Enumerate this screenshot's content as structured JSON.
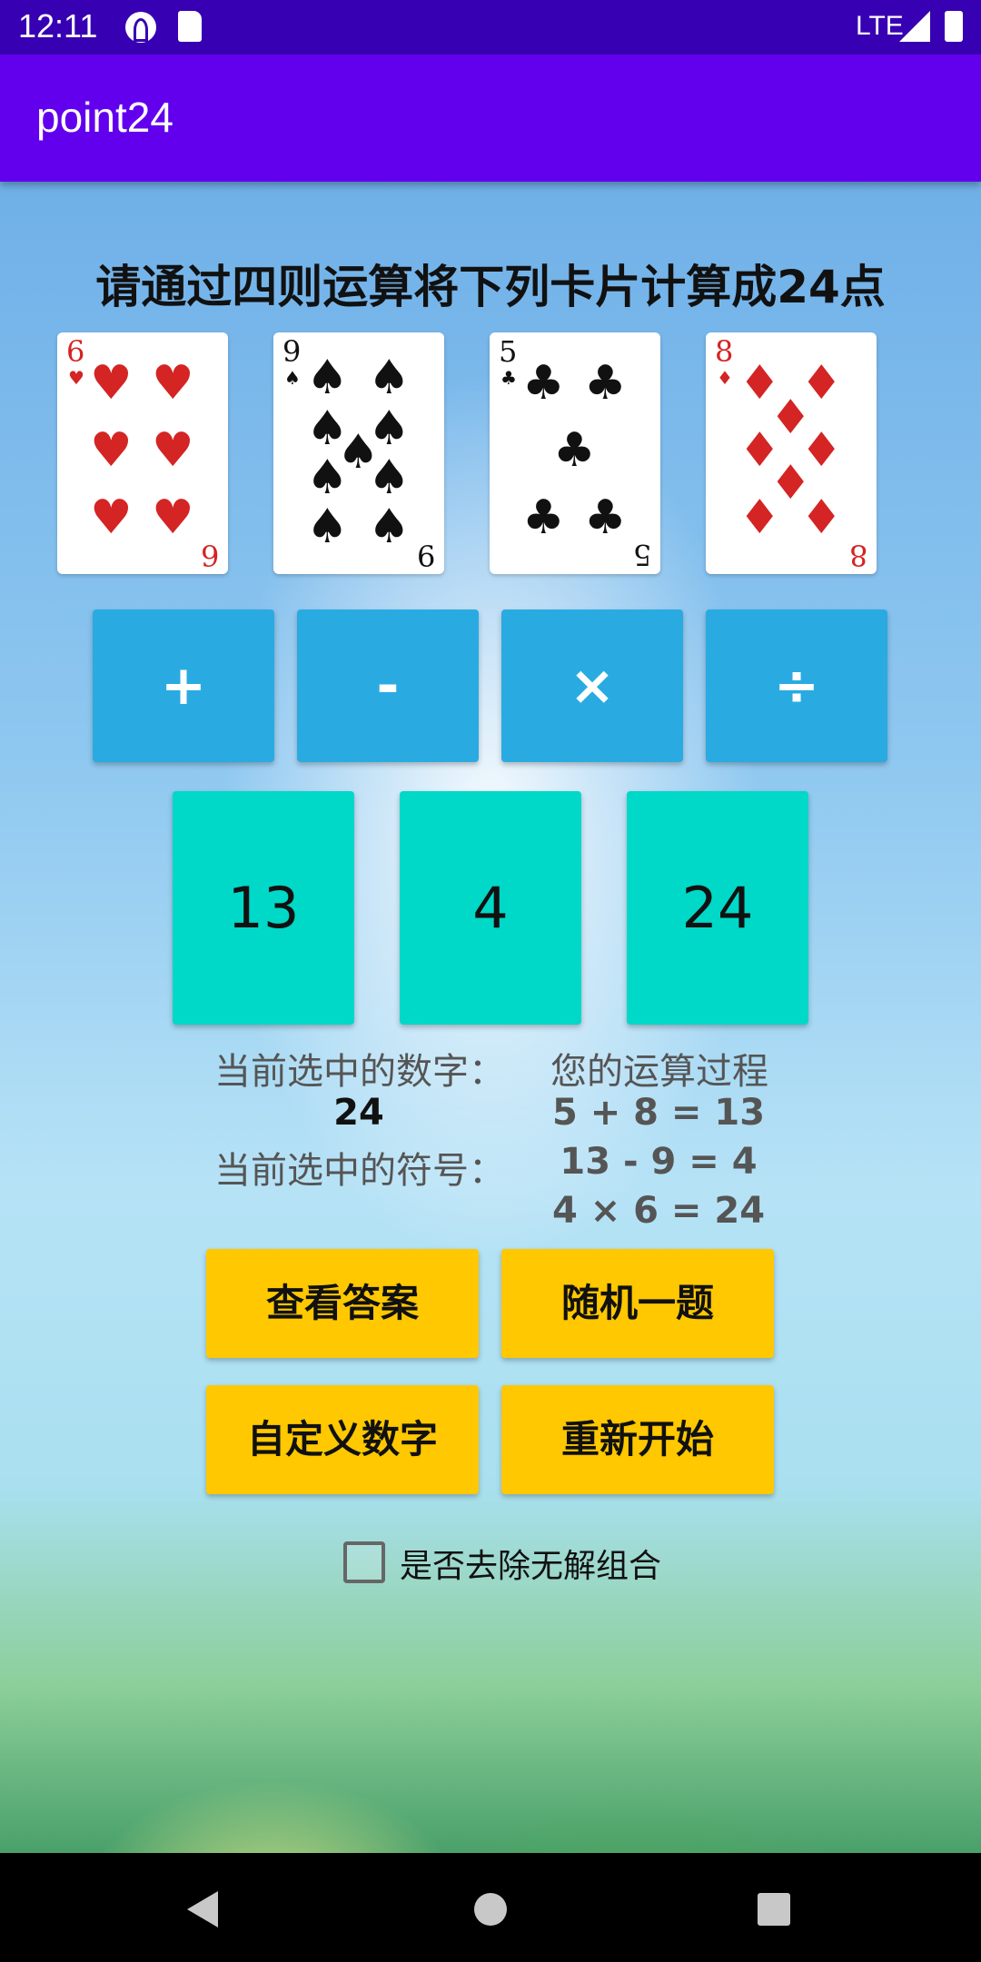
{
  "status_bar": {
    "time": "12:11",
    "network": "LTE"
  },
  "app_bar": {
    "title": "point24"
  },
  "instruction": "请通过四则运算将下列卡片计算成24点",
  "cards": [
    {
      "rank": "6",
      "suit": "♥",
      "color": "#d42424"
    },
    {
      "rank": "9",
      "suit": "♠",
      "color": "#111111"
    },
    {
      "rank": "5",
      "suit": "♣",
      "color": "#111111"
    },
    {
      "rank": "8",
      "suit": "♦",
      "color": "#d42424"
    }
  ],
  "operators": [
    "+",
    "-",
    "×",
    "÷"
  ],
  "numbers": [
    "13",
    "4",
    "24"
  ],
  "info": {
    "selected_number_label": "当前选中的数字：",
    "selected_number_value": "24",
    "selected_operator_label": "当前选中的符号：",
    "process_title": "您的运算过程",
    "process_steps": [
      "5 + 8 = 13",
      "13 - 9 = 4",
      "4 × 6 = 24"
    ]
  },
  "actions": {
    "view_answer": "查看答案",
    "random_question": "随机一题",
    "custom_numbers": "自定义数字",
    "restart": "重新开始"
  },
  "checkbox": {
    "label": "是否去除无解组合",
    "checked": false
  },
  "colors": {
    "status_bar": "#3700b3",
    "app_bar": "#6200ee",
    "operator_button": "#29abe2",
    "number_card": "#00d8c8",
    "action_button": "#ffc800"
  }
}
